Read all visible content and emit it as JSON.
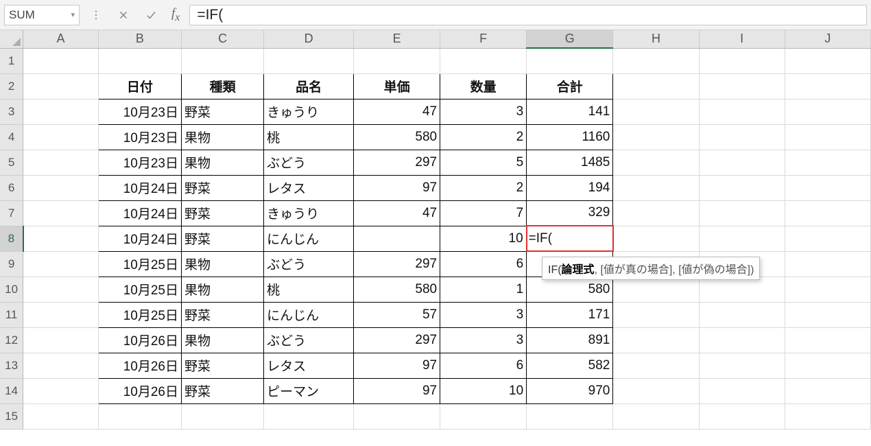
{
  "nameBox": "SUM",
  "formulaBarValue": "=IF(",
  "editingCellValue": "=IF(",
  "editingCellRef": "G8",
  "tooltip": {
    "fn": "IF(",
    "arg1": "論理式",
    "rest": ", [値が真の場合], [値が偽の場合])"
  },
  "columns": [
    "A",
    "B",
    "C",
    "D",
    "E",
    "F",
    "G",
    "H",
    "I",
    "J"
  ],
  "rowNumbers": [
    1,
    2,
    3,
    4,
    5,
    6,
    7,
    8,
    9,
    10,
    11,
    12,
    13,
    14,
    15
  ],
  "headers": {
    "B": "日付",
    "C": "種類",
    "D": "品名",
    "E": "単価",
    "F": "数量",
    "G": "合計"
  },
  "rows": [
    {
      "B": "10月23日",
      "C": "野菜",
      "D": "きゅうり",
      "E": "47",
      "F": "3",
      "G": "141"
    },
    {
      "B": "10月23日",
      "C": "果物",
      "D": "桃",
      "E": "580",
      "F": "2",
      "G": "1160"
    },
    {
      "B": "10月23日",
      "C": "果物",
      "D": "ぶどう",
      "E": "297",
      "F": "5",
      "G": "1485"
    },
    {
      "B": "10月24日",
      "C": "野菜",
      "D": "レタス",
      "E": "97",
      "F": "2",
      "G": "194"
    },
    {
      "B": "10月24日",
      "C": "野菜",
      "D": "きゅうり",
      "E": "47",
      "F": "7",
      "G": "329"
    },
    {
      "B": "10月24日",
      "C": "野菜",
      "D": "にんじん",
      "E": "",
      "F": "10",
      "G": "=IF("
    },
    {
      "B": "10月25日",
      "C": "果物",
      "D": "ぶどう",
      "E": "297",
      "F": "6",
      "G": ""
    },
    {
      "B": "10月25日",
      "C": "果物",
      "D": "桃",
      "E": "580",
      "F": "1",
      "G": "580"
    },
    {
      "B": "10月25日",
      "C": "野菜",
      "D": "にんじん",
      "E": "57",
      "F": "3",
      "G": "171"
    },
    {
      "B": "10月26日",
      "C": "果物",
      "D": "ぶどう",
      "E": "297",
      "F": "3",
      "G": "891"
    },
    {
      "B": "10月26日",
      "C": "野菜",
      "D": "レタス",
      "E": "97",
      "F": "6",
      "G": "582"
    },
    {
      "B": "10月26日",
      "C": "野菜",
      "D": "ピーマン",
      "E": "97",
      "F": "10",
      "G": "970"
    }
  ]
}
